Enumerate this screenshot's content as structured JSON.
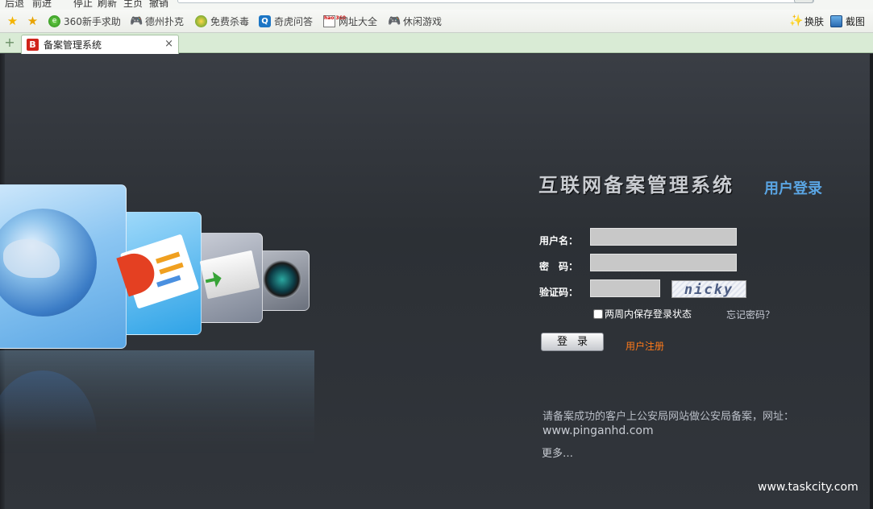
{
  "toolbar": {
    "back": "后退",
    "forward": "前进",
    "stop": "停止",
    "refresh": "刷新",
    "home": "主页",
    "undo": "撤销"
  },
  "favorites": [
    {
      "label": "360新手求助",
      "icon": "360-icon"
    },
    {
      "label": "德州扑克",
      "icon": "gamepad-icon"
    },
    {
      "label": "免费杀毒",
      "icon": "shield-icon"
    },
    {
      "label": "奇虎问答",
      "icon": "qihoo-icon"
    },
    {
      "label": "网址大全",
      "icon": "hao360-icon"
    },
    {
      "label": "休闲游戏",
      "icon": "gamepad-icon"
    }
  ],
  "right_tools": {
    "skin": "换肤",
    "screenshot": "截图"
  },
  "tab": {
    "badge": "B",
    "title": "备案管理系统",
    "close": "×"
  },
  "login": {
    "system_title": "互联网备案管理系统",
    "panel_title": "用户登录",
    "username_label": "用户名：",
    "password_label": "密　码：",
    "captcha_label": "验证码：",
    "captcha_text": "nicky",
    "remember_label": "两周内保存登录状态",
    "forgot_label": "忘记密码？",
    "login_button": "登录",
    "register_link": "用户注册",
    "username_value": "",
    "password_value": "",
    "captcha_value": ""
  },
  "notice": {
    "text": "请备案成功的客户上公安局网站做公安局备案，网址：",
    "url": "www.pinganhd.com",
    "more": "更多…"
  },
  "footer": "www.taskcity.com"
}
